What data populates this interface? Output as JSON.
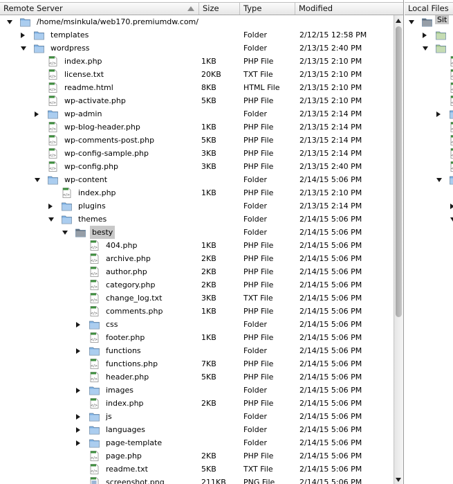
{
  "remote": {
    "columns": {
      "name": "Remote Server",
      "size": "Size",
      "type": "Type",
      "modified": "Modified"
    },
    "rows": [
      {
        "name": "/home/msinkula/web170.premiumdw.com/",
        "size": "",
        "type": "",
        "modified": "",
        "kind": "folder",
        "depth": 0,
        "expander": "open"
      },
      {
        "name": "templates",
        "size": "",
        "type": "Folder",
        "modified": "2/12/15 12:58 PM",
        "kind": "folder",
        "depth": 1,
        "expander": "closed"
      },
      {
        "name": "wordpress",
        "size": "",
        "type": "Folder",
        "modified": "2/13/15 2:40 PM",
        "kind": "folder",
        "depth": 1,
        "expander": "open"
      },
      {
        "name": "index.php",
        "size": "1KB",
        "type": "PHP File",
        "modified": "2/13/15 2:10 PM",
        "kind": "file",
        "depth": 2,
        "expander": "none"
      },
      {
        "name": "license.txt",
        "size": "20KB",
        "type": "TXT File",
        "modified": "2/13/15 2:10 PM",
        "kind": "file",
        "depth": 2,
        "expander": "none"
      },
      {
        "name": "readme.html",
        "size": "8KB",
        "type": "HTML File",
        "modified": "2/13/15 2:10 PM",
        "kind": "file",
        "depth": 2,
        "expander": "none"
      },
      {
        "name": "wp-activate.php",
        "size": "5KB",
        "type": "PHP File",
        "modified": "2/13/15 2:10 PM",
        "kind": "file",
        "depth": 2,
        "expander": "none"
      },
      {
        "name": "wp-admin",
        "size": "",
        "type": "Folder",
        "modified": "2/13/15 2:14 PM",
        "kind": "folder",
        "depth": 2,
        "expander": "closed"
      },
      {
        "name": "wp-blog-header.php",
        "size": "1KB",
        "type": "PHP File",
        "modified": "2/13/15 2:14 PM",
        "kind": "file",
        "depth": 2,
        "expander": "none"
      },
      {
        "name": "wp-comments-post.php",
        "size": "5KB",
        "type": "PHP File",
        "modified": "2/13/15 2:14 PM",
        "kind": "file",
        "depth": 2,
        "expander": "none"
      },
      {
        "name": "wp-config-sample.php",
        "size": "3KB",
        "type": "PHP File",
        "modified": "2/13/15 2:14 PM",
        "kind": "file",
        "depth": 2,
        "expander": "none"
      },
      {
        "name": "wp-config.php",
        "size": "3KB",
        "type": "PHP File",
        "modified": "2/13/15 2:40 PM",
        "kind": "file",
        "depth": 2,
        "expander": "none"
      },
      {
        "name": "wp-content",
        "size": "",
        "type": "Folder",
        "modified": "2/14/15 5:06 PM",
        "kind": "folder",
        "depth": 2,
        "expander": "open"
      },
      {
        "name": "index.php",
        "size": "1KB",
        "type": "PHP File",
        "modified": "2/13/15 2:10 PM",
        "kind": "file",
        "depth": 3,
        "expander": "none"
      },
      {
        "name": "plugins",
        "size": "",
        "type": "Folder",
        "modified": "2/13/15 2:14 PM",
        "kind": "folder",
        "depth": 3,
        "expander": "closed"
      },
      {
        "name": "themes",
        "size": "",
        "type": "Folder",
        "modified": "2/14/15 5:06 PM",
        "kind": "folder",
        "depth": 3,
        "expander": "open"
      },
      {
        "name": "besty",
        "size": "",
        "type": "Folder",
        "modified": "2/14/15 5:06 PM",
        "kind": "folder-dark",
        "depth": 4,
        "expander": "open",
        "selected": true
      },
      {
        "name": "404.php",
        "size": "1KB",
        "type": "PHP File",
        "modified": "2/14/15 5:06 PM",
        "kind": "file",
        "depth": 5,
        "expander": "none"
      },
      {
        "name": "archive.php",
        "size": "2KB",
        "type": "PHP File",
        "modified": "2/14/15 5:06 PM",
        "kind": "file",
        "depth": 5,
        "expander": "none"
      },
      {
        "name": "author.php",
        "size": "2KB",
        "type": "PHP File",
        "modified": "2/14/15 5:06 PM",
        "kind": "file",
        "depth": 5,
        "expander": "none"
      },
      {
        "name": "category.php",
        "size": "2KB",
        "type": "PHP File",
        "modified": "2/14/15 5:06 PM",
        "kind": "file",
        "depth": 5,
        "expander": "none"
      },
      {
        "name": "change_log.txt",
        "size": "3KB",
        "type": "TXT File",
        "modified": "2/14/15 5:06 PM",
        "kind": "file",
        "depth": 5,
        "expander": "none"
      },
      {
        "name": "comments.php",
        "size": "1KB",
        "type": "PHP File",
        "modified": "2/14/15 5:06 PM",
        "kind": "file",
        "depth": 5,
        "expander": "none"
      },
      {
        "name": "css",
        "size": "",
        "type": "Folder",
        "modified": "2/14/15 5:06 PM",
        "kind": "folder",
        "depth": 5,
        "expander": "closed"
      },
      {
        "name": "footer.php",
        "size": "1KB",
        "type": "PHP File",
        "modified": "2/14/15 5:06 PM",
        "kind": "file",
        "depth": 5,
        "expander": "none"
      },
      {
        "name": "functions",
        "size": "",
        "type": "Folder",
        "modified": "2/14/15 5:06 PM",
        "kind": "folder",
        "depth": 5,
        "expander": "closed"
      },
      {
        "name": "functions.php",
        "size": "7KB",
        "type": "PHP File",
        "modified": "2/14/15 5:06 PM",
        "kind": "file",
        "depth": 5,
        "expander": "none"
      },
      {
        "name": "header.php",
        "size": "5KB",
        "type": "PHP File",
        "modified": "2/14/15 5:06 PM",
        "kind": "file",
        "depth": 5,
        "expander": "none"
      },
      {
        "name": "images",
        "size": "",
        "type": "Folder",
        "modified": "2/14/15 5:06 PM",
        "kind": "folder",
        "depth": 5,
        "expander": "closed"
      },
      {
        "name": "index.php",
        "size": "2KB",
        "type": "PHP File",
        "modified": "2/14/15 5:06 PM",
        "kind": "file",
        "depth": 5,
        "expander": "none"
      },
      {
        "name": "js",
        "size": "",
        "type": "Folder",
        "modified": "2/14/15 5:06 PM",
        "kind": "folder",
        "depth": 5,
        "expander": "closed"
      },
      {
        "name": "languages",
        "size": "",
        "type": "Folder",
        "modified": "2/14/15 5:06 PM",
        "kind": "folder",
        "depth": 5,
        "expander": "closed"
      },
      {
        "name": "page-template",
        "size": "",
        "type": "Folder",
        "modified": "2/14/15 5:06 PM",
        "kind": "folder",
        "depth": 5,
        "expander": "closed"
      },
      {
        "name": "page.php",
        "size": "2KB",
        "type": "PHP File",
        "modified": "2/14/15 5:06 PM",
        "kind": "file",
        "depth": 5,
        "expander": "none"
      },
      {
        "name": "readme.txt",
        "size": "5KB",
        "type": "TXT File",
        "modified": "2/14/15 5:06 PM",
        "kind": "file",
        "depth": 5,
        "expander": "none"
      },
      {
        "name": "screenshot.png",
        "size": "211KB",
        "type": "PNG File",
        "modified": "2/14/15 5:06 PM",
        "kind": "image",
        "depth": 5,
        "expander": "none"
      }
    ]
  },
  "local": {
    "header": "Local Files",
    "root_label": "Sit",
    "tree": [
      {
        "depth": 0,
        "expander": "open",
        "icon": "folder-dark",
        "label": "Sit"
      },
      {
        "depth": 1,
        "expander": "closed",
        "icon": "folder-green",
        "label": ""
      },
      {
        "depth": 1,
        "expander": "open",
        "icon": "folder-green",
        "label": ""
      },
      {
        "depth": 2,
        "expander": "none",
        "icon": "file",
        "label": ""
      },
      {
        "depth": 2,
        "expander": "none",
        "icon": "file",
        "label": ""
      },
      {
        "depth": 2,
        "expander": "none",
        "icon": "file",
        "label": ""
      },
      {
        "depth": 2,
        "expander": "none",
        "icon": "file",
        "label": ""
      },
      {
        "depth": 2,
        "expander": "closed",
        "icon": "folder",
        "label": ""
      },
      {
        "depth": 2,
        "expander": "none",
        "icon": "file",
        "label": ""
      },
      {
        "depth": 2,
        "expander": "none",
        "icon": "file",
        "label": ""
      },
      {
        "depth": 2,
        "expander": "none",
        "icon": "file",
        "label": ""
      },
      {
        "depth": 2,
        "expander": "none",
        "icon": "file",
        "label": ""
      },
      {
        "depth": 2,
        "expander": "open",
        "icon": "folder",
        "label": ""
      },
      {
        "depth": 3,
        "expander": "none",
        "icon": "file",
        "label": ""
      },
      {
        "depth": 3,
        "expander": "closed",
        "icon": "folder",
        "label": ""
      },
      {
        "depth": 3,
        "expander": "open",
        "icon": "folder",
        "label": ""
      },
      {
        "depth": 4,
        "expander": "none",
        "icon": "file",
        "label": ""
      },
      {
        "depth": 4,
        "expander": "none",
        "icon": "file",
        "label": ""
      },
      {
        "depth": 4,
        "expander": "none",
        "icon": "file",
        "label": ""
      },
      {
        "depth": 4,
        "expander": "none",
        "icon": "file",
        "label": ""
      },
      {
        "depth": 4,
        "expander": "none",
        "icon": "file",
        "label": ""
      },
      {
        "depth": 4,
        "expander": "none",
        "icon": "file",
        "label": ""
      },
      {
        "depth": 4,
        "expander": "closed",
        "icon": "folder",
        "label": ""
      },
      {
        "depth": 4,
        "expander": "none",
        "icon": "file",
        "label": ""
      },
      {
        "depth": 4,
        "expander": "none",
        "icon": "file",
        "label": ""
      },
      {
        "depth": 4,
        "expander": "none",
        "icon": "file",
        "label": ""
      },
      {
        "depth": 4,
        "expander": "none",
        "icon": "file",
        "label": ""
      },
      {
        "depth": 4,
        "expander": "none",
        "icon": "file",
        "label": ""
      },
      {
        "depth": 4,
        "expander": "none",
        "icon": "file",
        "label": ""
      },
      {
        "depth": 4,
        "expander": "none",
        "icon": "file",
        "label": ""
      },
      {
        "depth": 4,
        "expander": "none",
        "icon": "file",
        "label": ""
      },
      {
        "depth": 4,
        "expander": "none",
        "icon": "file",
        "label": ""
      },
      {
        "depth": 4,
        "expander": "none",
        "icon": "file",
        "label": ""
      },
      {
        "depth": 4,
        "expander": "none",
        "icon": "file",
        "label": ""
      },
      {
        "depth": 4,
        "expander": "none",
        "icon": "file",
        "label": ""
      },
      {
        "depth": 4,
        "expander": "none",
        "icon": "file",
        "label": ""
      }
    ]
  },
  "colors": {
    "folder": "#7fb3e6",
    "folder_dark": "#5f6b78",
    "folder_green": "#a6c98a",
    "selection": "#c8c8c8",
    "php_green": "#3f8f3f"
  }
}
